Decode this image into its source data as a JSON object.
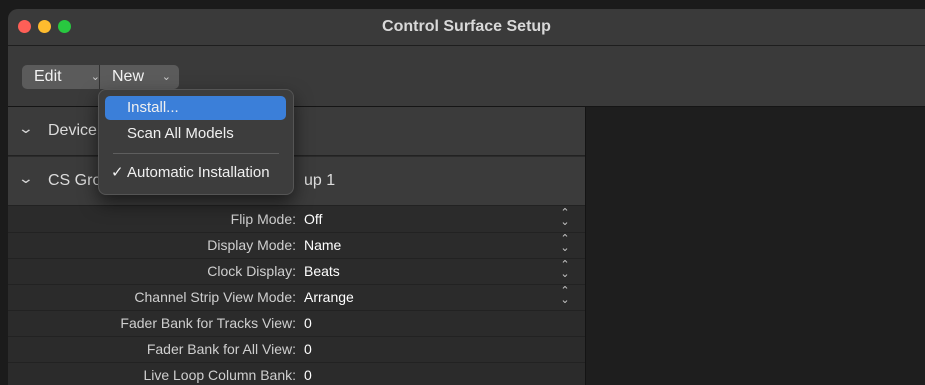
{
  "window": {
    "title": "Control Surface Setup"
  },
  "toolbar": {
    "edit_label": "Edit",
    "new_label": "New"
  },
  "menu": {
    "items": [
      {
        "label": "Install...",
        "highlighted": true
      },
      {
        "label": "Scan All Models"
      },
      {
        "label": "Automatic Installation",
        "checked": true
      }
    ]
  },
  "sections": [
    {
      "label": "Device"
    },
    {
      "label_visible_start": "CS Gro",
      "label_visible_end": "up 1"
    }
  ],
  "parameters": [
    {
      "label": "Flip Mode:",
      "value": "Off",
      "stepper": true
    },
    {
      "label": "Display Mode:",
      "value": "Name",
      "stepper": true
    },
    {
      "label": "Clock Display:",
      "value": "Beats",
      "stepper": true
    },
    {
      "label": "Channel Strip View Mode:",
      "value": "Arrange",
      "stepper": true
    },
    {
      "label": "Fader Bank for Tracks View:",
      "value": "0",
      "stepper": false
    },
    {
      "label": "Fader Bank for All View:",
      "value": "0",
      "stepper": false
    },
    {
      "label": "Live Loop Column Bank:",
      "value": "0",
      "stepper": false
    }
  ],
  "icons": {
    "chevron_down": "⌄",
    "checkmark": "✓",
    "stepper": "⌃⌄"
  },
  "colors": {
    "accent": "#3b7fd9",
    "close": "#fe5f57",
    "minimize": "#febc2e",
    "maximize": "#28c840"
  }
}
